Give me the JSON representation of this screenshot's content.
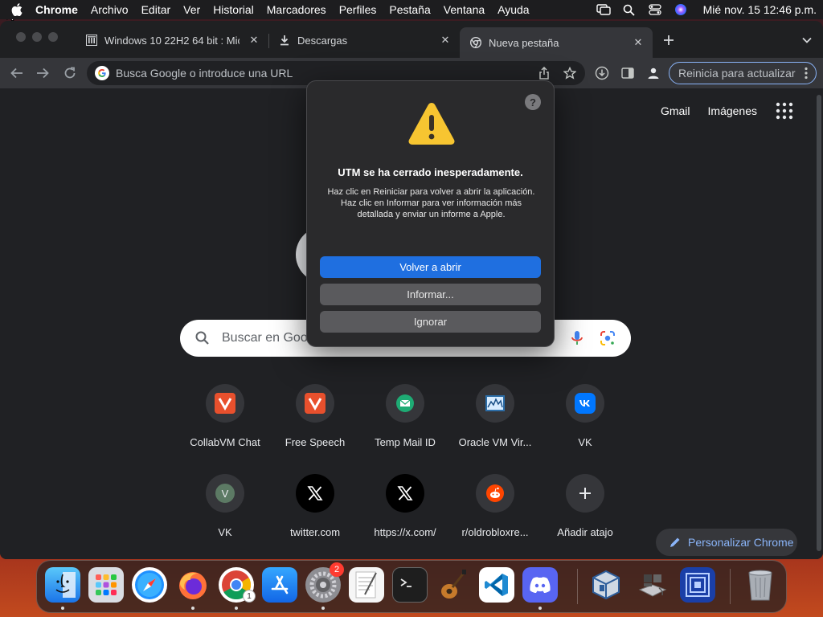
{
  "menubar": {
    "apple_icon": "apple-logo-icon",
    "items": [
      "Chrome",
      "Archivo",
      "Editar",
      "Ver",
      "Historial",
      "Marcadores",
      "Perfiles",
      "Pestaña",
      "Ventana",
      "Ayuda"
    ],
    "status_icons": [
      "screen-mirroring-icon",
      "spotlight-search-icon",
      "control-center-icon",
      "siri-icon"
    ],
    "clock": "Mié nov. 15  12:46 p.m."
  },
  "tabs": [
    {
      "title": "Windows 10 22H2 64 bit : Micr",
      "icon": "archive-building-icon"
    },
    {
      "title": "Descargas",
      "icon": "download-icon"
    },
    {
      "title": "Nueva pestaña",
      "icon": "chrome-icon",
      "active": true
    }
  ],
  "toolbar": {
    "omnibox_placeholder": "Busca Google o introduce una URL",
    "restart_label": "Reinicia para actualizar"
  },
  "ntp": {
    "top_links": [
      "Gmail",
      "Imágenes"
    ],
    "search_placeholder": "Buscar en Goo",
    "shortcuts": [
      {
        "label": "CollabVM Chat",
        "icon": "collabvm-v-icon"
      },
      {
        "label": "Free Speech",
        "icon": "collabvm-v-icon"
      },
      {
        "label": "Temp Mail ID",
        "icon": "mail-icon"
      },
      {
        "label": "Oracle VM Vir...",
        "icon": "virtualbox-chart-icon"
      },
      {
        "label": "VK",
        "icon": "vk-icon"
      },
      {
        "label": "VK",
        "icon": "letter-v-icon",
        "letter": "V"
      },
      {
        "label": "twitter.com",
        "icon": "x-logo-icon"
      },
      {
        "label": "https://x.com/",
        "icon": "x-logo-icon"
      },
      {
        "label": "r/oldrobloxre...",
        "icon": "reddit-icon"
      },
      {
        "label": "Añadir atajo",
        "icon": "plus-icon"
      }
    ],
    "customize_label": "Personalizar Chrome"
  },
  "dialog": {
    "title": "UTM se ha cerrado inesperadamente.",
    "message": "Haz clic en Reiniciar para volver a abrir la aplicación. Haz clic en Informar para ver información más detallada y enviar un informe a Apple.",
    "buttons": {
      "reopen": "Volver a abrir",
      "report": "Informar...",
      "ignore": "Ignorar"
    },
    "help_label": "?"
  },
  "dock": {
    "apps": [
      "finder",
      "launchpad",
      "safari",
      "firefox",
      "chrome",
      "app-store",
      "system-settings",
      "textedit",
      "terminal",
      "garageband",
      "vscode",
      "discord",
      "virtualbox",
      "boot-camp",
      "remote-desktop",
      "trash"
    ],
    "badges": {
      "system_settings": "2",
      "chrome": "1"
    }
  },
  "colors": {
    "accent": "#1f6fe0",
    "link": "#8ab4f8"
  }
}
